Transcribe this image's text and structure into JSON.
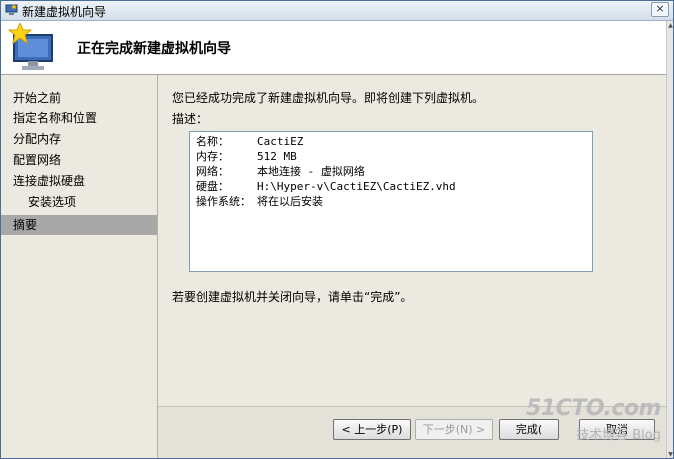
{
  "window": {
    "title": "新建虚拟机向导",
    "close_label": "×"
  },
  "header": {
    "title": "正在完成新建虚拟机向导"
  },
  "nav": {
    "items": [
      {
        "label": "开始之前"
      },
      {
        "label": "指定名称和位置"
      },
      {
        "label": "分配内存"
      },
      {
        "label": "配置网络"
      },
      {
        "label": "连接虚拟硬盘"
      },
      {
        "label": "安装选项"
      },
      {
        "label": "摘要"
      }
    ],
    "active_index": 6
  },
  "main": {
    "intro": "您已经成功完成了新建虚拟机向导。即将创建下列虚拟机。",
    "description_label": "描述：",
    "summary": [
      {
        "key": "名称：",
        "value": "CactiEZ"
      },
      {
        "key": "内存：",
        "value": "512 MB"
      },
      {
        "key": "网络：",
        "value": "本地连接 - 虚拟网络"
      },
      {
        "key": "硬盘：",
        "value": "H:\\Hyper-v\\CactiEZ\\CactiEZ.vhd"
      },
      {
        "key": "操作系统：",
        "value": "将在以后安装"
      }
    ],
    "finish_hint": "若要创建虚拟机并关闭向导，请单击“完成”。"
  },
  "buttons": {
    "back": "< 上一步(P)",
    "next": "下一步(N) >",
    "finish": "完成(",
    "cancel": "取消"
  },
  "watermark": {
    "logo": "51CTO.com",
    "sub": "技术博客 Blog"
  },
  "colors": {
    "active_nav": "#a8a8a8",
    "dialog_bg": "#ece9e0",
    "box_border": "#7f9db9"
  }
}
